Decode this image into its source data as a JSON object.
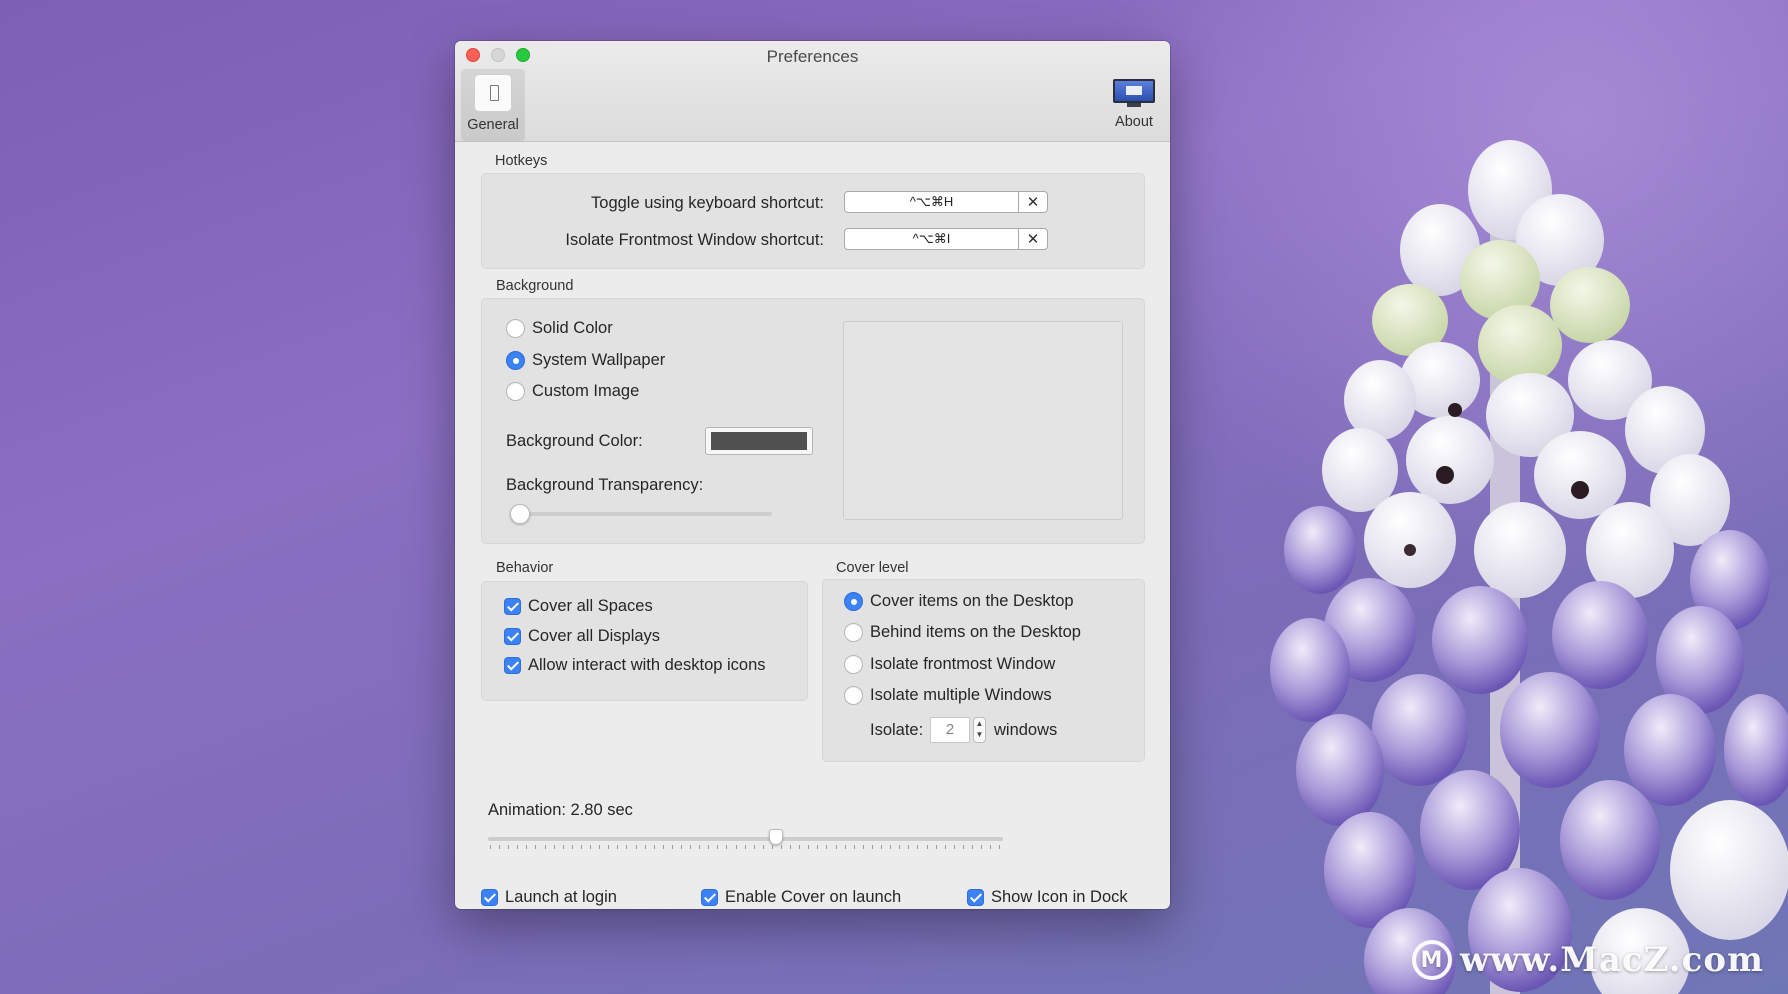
{
  "window": {
    "title": "Preferences",
    "toolbar": {
      "general_label": "General",
      "about_label": "About"
    }
  },
  "hotkeys": {
    "section_title": "Hotkeys",
    "toggle_label": "Toggle using keyboard shortcut:",
    "toggle_value": "^⌥⌘H",
    "isolate_label": "Isolate Frontmost Window shortcut:",
    "isolate_value": "^⌥⌘I",
    "clear_glyph": "✕"
  },
  "background": {
    "section_title": "Background",
    "options": [
      {
        "label": "Solid Color",
        "selected": false
      },
      {
        "label": "System Wallpaper",
        "selected": true
      },
      {
        "label": "Custom Image",
        "selected": false
      }
    ],
    "color_label": "Background Color:",
    "color_value": "#505050",
    "transparency_label": "Background Transparency:",
    "transparency_value": 0
  },
  "behavior": {
    "section_title": "Behavior",
    "options": [
      {
        "label": "Cover all Spaces",
        "checked": true
      },
      {
        "label": "Cover all Displays",
        "checked": true
      },
      {
        "label": "Allow interact with desktop icons",
        "checked": true
      }
    ]
  },
  "cover_level": {
    "section_title": "Cover level",
    "options": [
      {
        "label": "Cover items on the Desktop",
        "selected": true
      },
      {
        "label": "Behind items on the Desktop",
        "selected": false
      },
      {
        "label": "Isolate frontmost Window",
        "selected": false
      },
      {
        "label": "Isolate multiple Windows",
        "selected": false
      }
    ],
    "isolate_label": "Isolate:",
    "isolate_count": "2",
    "isolate_unit": "windows"
  },
  "animation": {
    "label": "Animation: 2.80 sec",
    "value_fraction": 0.56
  },
  "footer": {
    "launch_at_login": {
      "label": "Launch at login",
      "checked": true
    },
    "enable_cover": {
      "label": "Enable Cover on launch",
      "checked": true
    },
    "show_icon": {
      "label": "Show Icon in Dock",
      "checked": true
    }
  },
  "watermark": {
    "text": "www.MacZ.com"
  },
  "colors": {
    "accent": "#3b82f7",
    "close": "#fe5f57",
    "zoom": "#28c840"
  }
}
